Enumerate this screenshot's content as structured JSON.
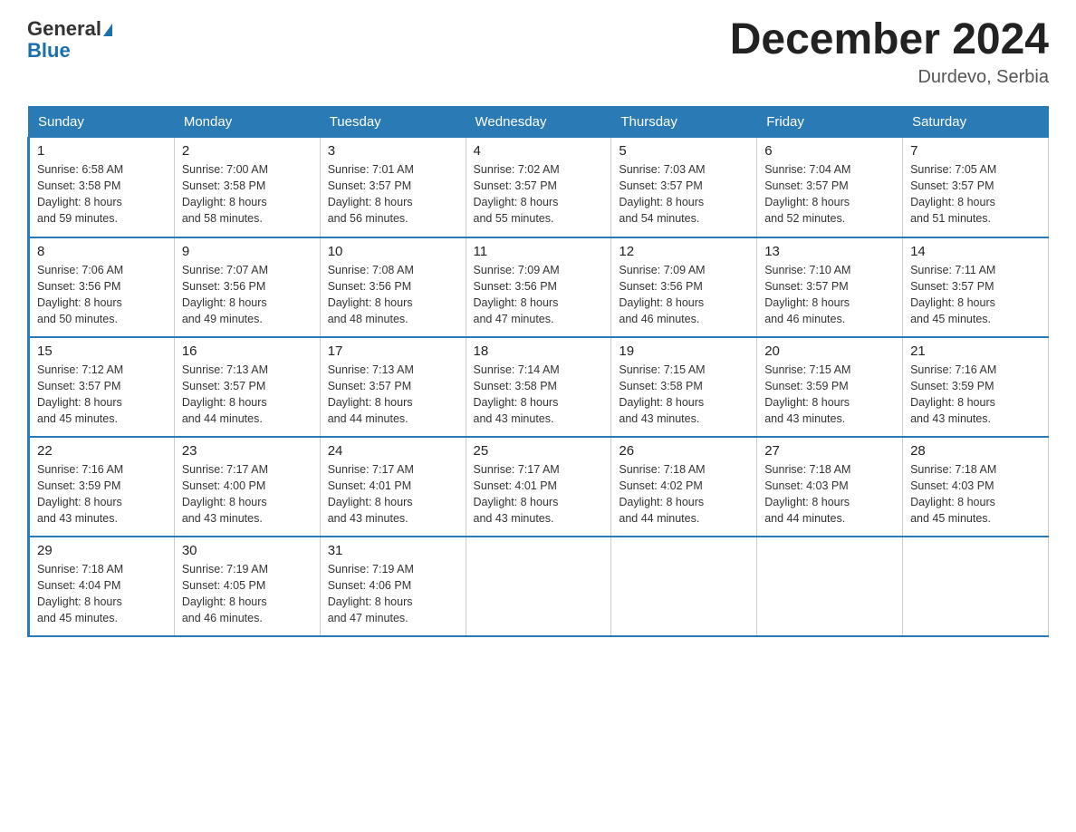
{
  "header": {
    "logo_line1": "General",
    "logo_line2": "Blue",
    "month_title": "December 2024",
    "location": "Durdevo, Serbia"
  },
  "days_of_week": [
    "Sunday",
    "Monday",
    "Tuesday",
    "Wednesday",
    "Thursday",
    "Friday",
    "Saturday"
  ],
  "weeks": [
    [
      {
        "day": "1",
        "sunrise": "6:58 AM",
        "sunset": "3:58 PM",
        "daylight": "8 hours and 59 minutes."
      },
      {
        "day": "2",
        "sunrise": "7:00 AM",
        "sunset": "3:58 PM",
        "daylight": "8 hours and 58 minutes."
      },
      {
        "day": "3",
        "sunrise": "7:01 AM",
        "sunset": "3:57 PM",
        "daylight": "8 hours and 56 minutes."
      },
      {
        "day": "4",
        "sunrise": "7:02 AM",
        "sunset": "3:57 PM",
        "daylight": "8 hours and 55 minutes."
      },
      {
        "day": "5",
        "sunrise": "7:03 AM",
        "sunset": "3:57 PM",
        "daylight": "8 hours and 54 minutes."
      },
      {
        "day": "6",
        "sunrise": "7:04 AM",
        "sunset": "3:57 PM",
        "daylight": "8 hours and 52 minutes."
      },
      {
        "day": "7",
        "sunrise": "7:05 AM",
        "sunset": "3:57 PM",
        "daylight": "8 hours and 51 minutes."
      }
    ],
    [
      {
        "day": "8",
        "sunrise": "7:06 AM",
        "sunset": "3:56 PM",
        "daylight": "8 hours and 50 minutes."
      },
      {
        "day": "9",
        "sunrise": "7:07 AM",
        "sunset": "3:56 PM",
        "daylight": "8 hours and 49 minutes."
      },
      {
        "day": "10",
        "sunrise": "7:08 AM",
        "sunset": "3:56 PM",
        "daylight": "8 hours and 48 minutes."
      },
      {
        "day": "11",
        "sunrise": "7:09 AM",
        "sunset": "3:56 PM",
        "daylight": "8 hours and 47 minutes."
      },
      {
        "day": "12",
        "sunrise": "7:09 AM",
        "sunset": "3:56 PM",
        "daylight": "8 hours and 46 minutes."
      },
      {
        "day": "13",
        "sunrise": "7:10 AM",
        "sunset": "3:57 PM",
        "daylight": "8 hours and 46 minutes."
      },
      {
        "day": "14",
        "sunrise": "7:11 AM",
        "sunset": "3:57 PM",
        "daylight": "8 hours and 45 minutes."
      }
    ],
    [
      {
        "day": "15",
        "sunrise": "7:12 AM",
        "sunset": "3:57 PM",
        "daylight": "8 hours and 45 minutes."
      },
      {
        "day": "16",
        "sunrise": "7:13 AM",
        "sunset": "3:57 PM",
        "daylight": "8 hours and 44 minutes."
      },
      {
        "day": "17",
        "sunrise": "7:13 AM",
        "sunset": "3:57 PM",
        "daylight": "8 hours and 44 minutes."
      },
      {
        "day": "18",
        "sunrise": "7:14 AM",
        "sunset": "3:58 PM",
        "daylight": "8 hours and 43 minutes."
      },
      {
        "day": "19",
        "sunrise": "7:15 AM",
        "sunset": "3:58 PM",
        "daylight": "8 hours and 43 minutes."
      },
      {
        "day": "20",
        "sunrise": "7:15 AM",
        "sunset": "3:59 PM",
        "daylight": "8 hours and 43 minutes."
      },
      {
        "day": "21",
        "sunrise": "7:16 AM",
        "sunset": "3:59 PM",
        "daylight": "8 hours and 43 minutes."
      }
    ],
    [
      {
        "day": "22",
        "sunrise": "7:16 AM",
        "sunset": "3:59 PM",
        "daylight": "8 hours and 43 minutes."
      },
      {
        "day": "23",
        "sunrise": "7:17 AM",
        "sunset": "4:00 PM",
        "daylight": "8 hours and 43 minutes."
      },
      {
        "day": "24",
        "sunrise": "7:17 AM",
        "sunset": "4:01 PM",
        "daylight": "8 hours and 43 minutes."
      },
      {
        "day": "25",
        "sunrise": "7:17 AM",
        "sunset": "4:01 PM",
        "daylight": "8 hours and 43 minutes."
      },
      {
        "day": "26",
        "sunrise": "7:18 AM",
        "sunset": "4:02 PM",
        "daylight": "8 hours and 44 minutes."
      },
      {
        "day": "27",
        "sunrise": "7:18 AM",
        "sunset": "4:03 PM",
        "daylight": "8 hours and 44 minutes."
      },
      {
        "day": "28",
        "sunrise": "7:18 AM",
        "sunset": "4:03 PM",
        "daylight": "8 hours and 45 minutes."
      }
    ],
    [
      {
        "day": "29",
        "sunrise": "7:18 AM",
        "sunset": "4:04 PM",
        "daylight": "8 hours and 45 minutes."
      },
      {
        "day": "30",
        "sunrise": "7:19 AM",
        "sunset": "4:05 PM",
        "daylight": "8 hours and 46 minutes."
      },
      {
        "day": "31",
        "sunrise": "7:19 AM",
        "sunset": "4:06 PM",
        "daylight": "8 hours and 47 minutes."
      },
      null,
      null,
      null,
      null
    ]
  ],
  "labels": {
    "sunrise": "Sunrise:",
    "sunset": "Sunset:",
    "daylight": "Daylight:"
  }
}
